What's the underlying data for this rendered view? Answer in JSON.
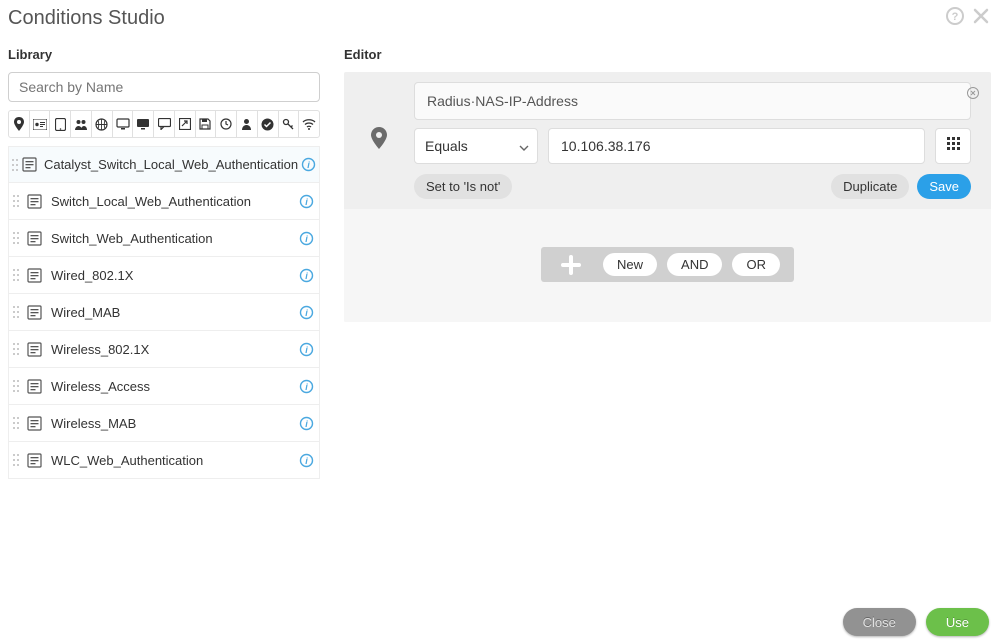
{
  "title": "Conditions Studio",
  "library": {
    "label": "Library",
    "search_placeholder": "Search by Name",
    "items": [
      {
        "label": "Catalyst_Switch_Local_Web_Authentication"
      },
      {
        "label": "Switch_Local_Web_Authentication"
      },
      {
        "label": "Switch_Web_Authentication"
      },
      {
        "label": "Wired_802.1X"
      },
      {
        "label": "Wired_MAB"
      },
      {
        "label": "Wireless_802.1X"
      },
      {
        "label": "Wireless_Access"
      },
      {
        "label": "Wireless_MAB"
      },
      {
        "label": "WLC_Web_Authentication"
      }
    ]
  },
  "editor": {
    "label": "Editor",
    "condition": {
      "attribute": "Radius·NAS-IP-Address",
      "operator": "Equals",
      "value": "10.106.38.176",
      "set_is_not": "Set to 'Is not'",
      "duplicate": "Duplicate",
      "save": "Save"
    },
    "logic": {
      "new": "New",
      "and": "AND",
      "or": "OR"
    }
  },
  "footer": {
    "close": "Close",
    "use": "Use"
  }
}
